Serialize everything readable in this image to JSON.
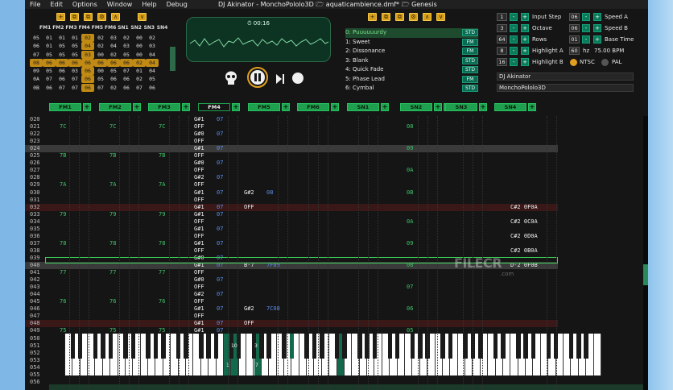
{
  "menu": [
    "File",
    "Edit",
    "Options",
    "Window",
    "Help",
    "Debug"
  ],
  "window_title": "DJ Akinator - MonchoPololo3D 🗁 aquaticambience.dmf* 🗁 Genesis",
  "left_toolbar": [
    "+",
    "⧉",
    "⧉",
    "⚙",
    "∧",
    "∨"
  ],
  "mixer": {
    "headers": [
      "FM1",
      "FM2",
      "FM3",
      "FM4",
      "FM5",
      "FM6",
      "SN1",
      "SN2",
      "SN3",
      "SN4"
    ],
    "rows": [
      [
        "05",
        "01",
        "01",
        "01",
        "02",
        "02",
        "03",
        "02",
        "00",
        "02"
      ],
      [
        "06",
        "01",
        "05",
        "05",
        "04",
        "02",
        "04",
        "03",
        "00",
        "03"
      ],
      [
        "07",
        "05",
        "05",
        "05",
        "03",
        "00",
        "02",
        "05",
        "00",
        "04"
      ],
      [
        "08",
        "06",
        "06",
        "06",
        "06",
        "06",
        "06",
        "06",
        "02",
        "04"
      ],
      [
        "09",
        "05",
        "06",
        "03",
        "06",
        "00",
        "05",
        "07",
        "01",
        "04"
      ],
      [
        "0A",
        "07",
        "06",
        "07",
        "06",
        "05",
        "06",
        "06",
        "02",
        "05"
      ],
      [
        "0B",
        "06",
        "07",
        "07",
        "06",
        "07",
        "02",
        "06",
        "07",
        "06"
      ]
    ],
    "highlight": [
      [
        0,
        4
      ],
      [
        1,
        4
      ],
      [
        2,
        4
      ],
      [
        3,
        0
      ],
      [
        3,
        1
      ],
      [
        3,
        2
      ],
      [
        3,
        3
      ],
      [
        3,
        4
      ],
      [
        3,
        5
      ],
      [
        3,
        6
      ],
      [
        3,
        7
      ],
      [
        3,
        8
      ],
      [
        3,
        9
      ],
      [
        4,
        4
      ],
      [
        5,
        4
      ],
      [
        6,
        4
      ]
    ]
  },
  "scope": {
    "time": "⏱ 00:16"
  },
  "right_toolbar": [
    "+",
    "⧉",
    "⧉",
    "⚙",
    "∧",
    "∨"
  ],
  "instruments": [
    {
      "label": "0: Puuuuuurdy",
      "tag": "STD"
    },
    {
      "label": "1: Sweet",
      "tag": "FM"
    },
    {
      "label": "2: Dissonance",
      "tag": "FM"
    },
    {
      "label": "3: Blank",
      "tag": "STD"
    },
    {
      "label": "4: Quick Fade",
      "tag": "STD"
    },
    {
      "label": "5: Phase Lead",
      "tag": "FM"
    },
    {
      "label": "6: Cymbal",
      "tag": "STD"
    }
  ],
  "settings": {
    "input_step": {
      "label": "Input Step",
      "value": "1"
    },
    "octave": {
      "label": "Octave",
      "value": "3"
    },
    "rows": {
      "label": "Rows",
      "value": "64"
    },
    "highlight_a": {
      "label": "Highlight A",
      "value": "8"
    },
    "highlight_b": {
      "label": "Highlight B",
      "value": "16"
    },
    "speed_a": {
      "label": "Speed A",
      "value": "06"
    },
    "speed_b": {
      "label": "Speed B",
      "value": "06"
    },
    "base_time": {
      "label": "Base Time",
      "value": "01"
    },
    "hz": {
      "value": "60",
      "unit": "hz",
      "bpm": "75.00 BPM"
    },
    "ntsc": "NTSC",
    "pal": "PAL"
  },
  "author": "DJ Akinator",
  "song_name": "MonchoPololo3D",
  "channels": [
    "FM1",
    "FM2",
    "FM3",
    "FM4",
    "FM5",
    "FM6",
    "SN1",
    "SN2",
    "SN3",
    "SN4"
  ],
  "pattern": {
    "row_numbers": [
      "020",
      "021",
      "022",
      "023",
      "024",
      "025",
      "026",
      "027",
      "028",
      "029",
      "030",
      "031",
      "032",
      "033",
      "034",
      "035",
      "036",
      "037",
      "038",
      "039",
      "040",
      "041",
      "042",
      "043",
      "044",
      "045",
      "046",
      "047",
      "048",
      "049",
      "050",
      "051",
      "052",
      "053",
      "054",
      "055",
      "056"
    ],
    "fm1": [
      "",
      "7C",
      "",
      "",
      "",
      "7B",
      "",
      "",
      "",
      "7A",
      "",
      "",
      "",
      "79",
      "",
      "",
      "",
      "78",
      "",
      "",
      "",
      "77",
      "",
      "",
      "",
      "76",
      "",
      "",
      "",
      "75",
      "",
      "",
      "",
      "",
      "",
      "",
      ""
    ],
    "fm4_notes": [
      "G#1",
      "OFF",
      "G#0",
      "OFF",
      "G#1",
      "OFF",
      "G#0",
      "OFF",
      "G#2",
      "OFF",
      "G#1",
      "OFF",
      "G#1",
      "G#1",
      "OFF",
      "G#1",
      "OFF",
      "G#1",
      "OFF",
      "G#0",
      "G#1",
      "OFF",
      "G#0",
      "OFF",
      "G#2",
      "OFF",
      "G#1",
      "OFF",
      "G#1",
      "G#1",
      "",
      "",
      "",
      "",
      "",
      "",
      ""
    ],
    "fm4_vols": [
      "07",
      "",
      "07",
      "",
      "07",
      "",
      "07",
      "",
      "07",
      "",
      "07",
      "",
      "07",
      "07",
      "",
      "07",
      "",
      "07",
      "",
      "07",
      "07",
      "",
      "07",
      "",
      "07",
      "",
      "07",
      "",
      "07",
      "07",
      "",
      "",
      "",
      "",
      "",
      "",
      ""
    ],
    "fm5_notes": [
      "",
      "",
      "",
      "",
      "",
      "",
      "",
      "",
      "",
      "",
      "G#2",
      "",
      "OFF",
      "",
      "",
      "",
      "",
      "",
      "",
      "",
      "B-7",
      "",
      "",
      "",
      "",
      "",
      "G#2",
      "",
      "OFF",
      "",
      "",
      "",
      "",
      "",
      "",
      "",
      ""
    ],
    "fm5_vols": [
      "",
      "",
      "",
      "",
      "",
      "",
      "",
      "",
      "",
      "",
      "08",
      "",
      "",
      "",
      "",
      "",
      "",
      "",
      "",
      "",
      "7F09",
      "",
      "",
      "",
      "",
      "",
      "7C08",
      "",
      "",
      "",
      "",
      "",
      "",
      "",
      "",
      "",
      ""
    ],
    "sn2": [
      "",
      "08",
      "",
      "",
      "09",
      "",
      "",
      "0A",
      "",
      "",
      "0B",
      "",
      "",
      "",
      "0A",
      "",
      "",
      "09",
      "",
      "",
      "08",
      "",
      "",
      "07",
      "",
      "",
      "06",
      "",
      "",
      "05",
      "",
      "",
      "",
      "",
      "",
      "",
      ""
    ],
    "sn4": [
      "",
      "",
      "",
      "",
      "",
      "",
      "",
      "",
      "",
      "",
      "",
      "",
      "C#2 0F0A",
      "",
      "C#2 0C0A",
      "",
      "C#2 0D0A",
      "",
      "C#2 0B0A",
      "",
      "D-2 0F0B",
      "",
      "",
      "",
      "",
      "",
      "",
      "",
      "",
      "",
      "",
      "",
      "",
      "",
      "",
      "",
      ""
    ],
    "highlight_rows": [
      4,
      12,
      20,
      28
    ],
    "red_rows": [
      12,
      28
    ],
    "cursor_row": 19
  },
  "piano": {
    "labels": [
      "10",
      "2",
      "3",
      "1",
      "7",
      "8"
    ]
  },
  "watermark": {
    "text": "FILECR",
    "sub": ".com"
  }
}
